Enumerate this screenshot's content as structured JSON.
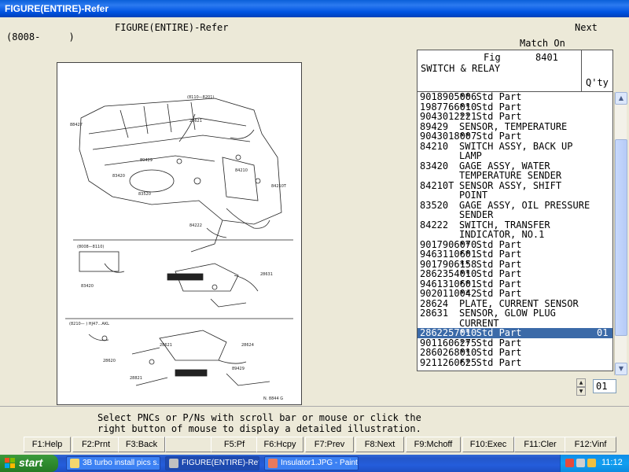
{
  "window": {
    "title": "FIGURE(ENTIRE)-Refer"
  },
  "header": {
    "title": "FIGURE(ENTIRE)-Refer",
    "range": "(8008-     )",
    "next": "Next",
    "match": "Match On"
  },
  "parts_header": {
    "fig_label": "Fig",
    "fig_number": "8401",
    "name": "SWITCH & RELAY",
    "qty_label": "Q'ty"
  },
  "parts": [
    {
      "pn": "9018905006",
      "desc": "** Std Part",
      "qty": ""
    },
    {
      "pn": "1987766010",
      "desc": "** Std Part",
      "qty": ""
    },
    {
      "pn": "9043012221",
      "desc": "** Std Part",
      "qty": ""
    },
    {
      "pn": "89429",
      "desc": "SENSOR, TEMPERATURE",
      "qty": ""
    },
    {
      "pn": "9043018007",
      "desc": "** Std Part",
      "qty": ""
    },
    {
      "pn": "84210",
      "desc": "SWITCH ASSY, BACK UP",
      "qty": ""
    },
    {
      "pn": "",
      "desc": "LAMP",
      "qty": ""
    },
    {
      "pn": "83420",
      "desc": "GAGE ASSY, WATER",
      "qty": ""
    },
    {
      "pn": "",
      "desc": "TEMPERATURE SENDER",
      "qty": ""
    },
    {
      "pn": "84210T",
      "desc": "SENSOR ASSY, SHIFT",
      "qty": ""
    },
    {
      "pn": "",
      "desc": "POINT",
      "qty": ""
    },
    {
      "pn": "83520",
      "desc": "GAGE ASSY, OIL PRESSURE",
      "qty": ""
    },
    {
      "pn": "",
      "desc": "SENDER",
      "qty": ""
    },
    {
      "pn": "84222",
      "desc": "SWITCH, TRANSFER",
      "qty": ""
    },
    {
      "pn": "",
      "desc": "INDICATOR, NO.1",
      "qty": ""
    },
    {
      "pn": "9017906070",
      "desc": "** Std Part",
      "qty": ""
    },
    {
      "pn": "9463110601",
      "desc": "** Std Part",
      "qty": ""
    },
    {
      "pn": "9017906158",
      "desc": "** Std Part",
      "qty": ""
    },
    {
      "pn": "2862354010",
      "desc": "** Std Part",
      "qty": ""
    },
    {
      "pn": "9461310601",
      "desc": "** Std Part",
      "qty": ""
    },
    {
      "pn": "9020110042",
      "desc": "** Std Part",
      "qty": ""
    },
    {
      "pn": "28624",
      "desc": "PLATE, CURRENT SENSOR",
      "qty": ""
    },
    {
      "pn": "28631",
      "desc": "SENSOR, GLOW PLUG",
      "qty": ""
    },
    {
      "pn": "",
      "desc": "CURRENT",
      "qty": ""
    },
    {
      "pn": "2862257010",
      "desc": "** Std Part",
      "qty": "01",
      "selected": true
    },
    {
      "pn": "9011606275",
      "desc": "** Std Part",
      "qty": ""
    },
    {
      "pn": "2860268010",
      "desc": "** Std Part",
      "qty": ""
    },
    {
      "pn": "9211260625",
      "desc": "** Std Part",
      "qty": ""
    }
  ],
  "qty_field": "01",
  "message": {
    "line1": "Select PNCs or P/Ns with scroll bar or mouse or click the",
    "line2": "right button of mouse to display a detailed illustration."
  },
  "fkeys": [
    "F1:Help",
    "F2:Prnt",
    "F3:Back",
    "",
    "F5:Pf",
    "F6:Hcpy",
    "F7:Prev",
    "F8:Next",
    "F9:Mchoff",
    "F10:Exec",
    "F11:Cler",
    "F12:Vinf"
  ],
  "figure_labels": {
    "top_range": "(8110—8201)",
    "mid_range": "(8008—8110)",
    "bot_range": "(8210—    ) HJ47…AKL",
    "code": "N. 8844 G",
    "callouts": [
      "88427",
      "89429",
      "83420",
      "83520",
      "28621",
      "84210",
      "84210T",
      "84222",
      "28631",
      "28624",
      "28621",
      "89429",
      "28620",
      "83420",
      "28821"
    ]
  },
  "taskbar": {
    "start": "start",
    "tasks": [
      "3B turbo install pics s...",
      "FIGURE(ENTIRE)-Refer",
      "Insulator1.JPG - Paint"
    ],
    "clock": "11:12"
  }
}
